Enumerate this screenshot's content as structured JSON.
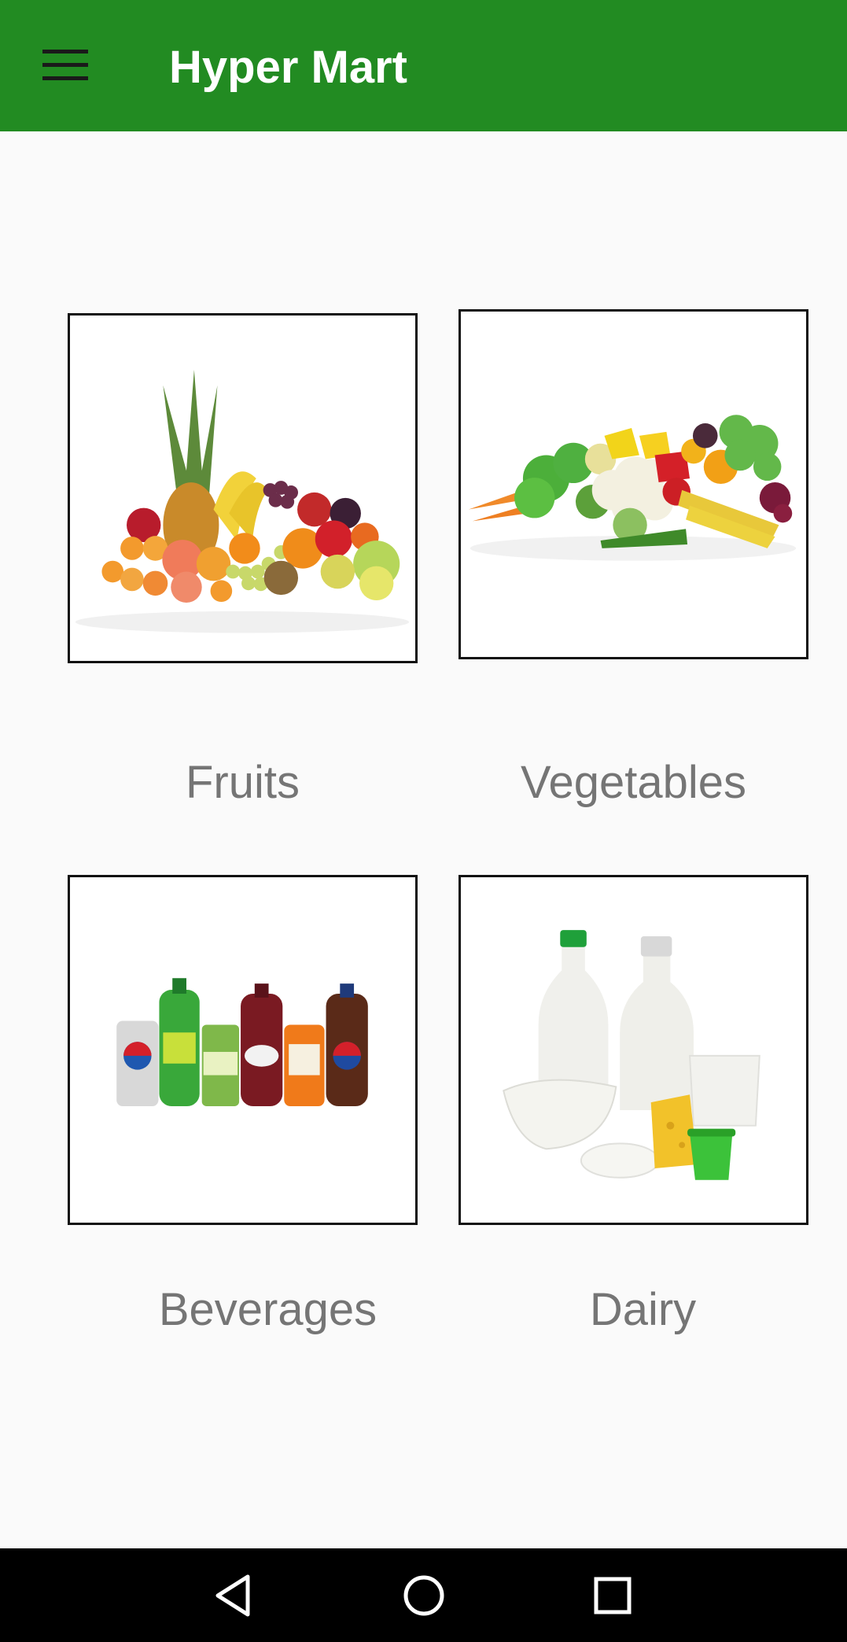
{
  "app": {
    "title": "Hyper Mart",
    "accent_color": "#228b22"
  },
  "toolbar": {
    "menu_icon": "hamburger-menu-icon"
  },
  "categories": [
    {
      "label": "Fruits",
      "image": "fruits-photo"
    },
    {
      "label": "Vegetables",
      "image": "vegetables-photo"
    },
    {
      "label": "Beverages",
      "image": "beverages-photo"
    },
    {
      "label": "Dairy",
      "image": "dairy-photo"
    }
  ],
  "system_nav": {
    "back_icon": "back-triangle-icon",
    "home_icon": "home-circle-icon",
    "recents_icon": "recents-square-icon"
  }
}
